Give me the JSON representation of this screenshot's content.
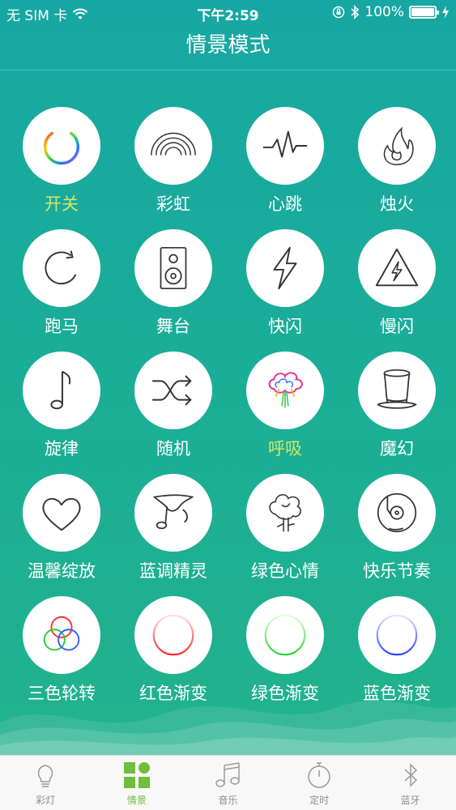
{
  "status_bar": {
    "carrier": "无 SIM 卡",
    "time": "下午2:59",
    "battery": "100%"
  },
  "header": {
    "title": "情景模式"
  },
  "modes": [
    {
      "label": "开关",
      "icon": "power-icon",
      "active": true
    },
    {
      "label": "彩虹",
      "icon": "rainbow-icon"
    },
    {
      "label": "心跳",
      "icon": "heartbeat-icon"
    },
    {
      "label": "烛火",
      "icon": "flame-icon"
    },
    {
      "label": "跑马",
      "icon": "rotate-icon"
    },
    {
      "label": "舞台",
      "icon": "speaker-icon"
    },
    {
      "label": "快闪",
      "icon": "lightning-icon"
    },
    {
      "label": "慢闪",
      "icon": "warning-lightning-icon"
    },
    {
      "label": "旋律",
      "icon": "music-note-icon"
    },
    {
      "label": "随机",
      "icon": "shuffle-icon"
    },
    {
      "label": "呼吸",
      "icon": "colorful-cloud-icon",
      "active": true
    },
    {
      "label": "魔幻",
      "icon": "magic-hat-icon"
    },
    {
      "label": "温馨绽放",
      "icon": "heart-icon"
    },
    {
      "label": "蓝调精灵",
      "icon": "blues-note-icon"
    },
    {
      "label": "绿色心情",
      "icon": "tree-icon"
    },
    {
      "label": "快乐节奏",
      "icon": "record-player-icon"
    },
    {
      "label": "三色轮转",
      "icon": "tricolor-rings-icon"
    },
    {
      "label": "红色渐变",
      "icon": "red-ring-icon"
    },
    {
      "label": "绿色渐变",
      "icon": "green-ring-icon"
    },
    {
      "label": "蓝色渐变",
      "icon": "blue-ring-icon"
    }
  ],
  "tabs": [
    {
      "label": "彩灯",
      "icon": "bulb-icon"
    },
    {
      "label": "情景",
      "icon": "grid-icon",
      "active": true
    },
    {
      "label": "音乐",
      "icon": "music-icon"
    },
    {
      "label": "定时",
      "icon": "stopwatch-icon"
    },
    {
      "label": "蓝牙",
      "icon": "bluetooth-icon"
    }
  ],
  "colors": {
    "accent": "#cfe869",
    "tab_active": "#6fbf3a",
    "tab_inactive": "#8e8e8e",
    "background_top": "#17a7a3",
    "background_bottom": "#22b28d"
  }
}
